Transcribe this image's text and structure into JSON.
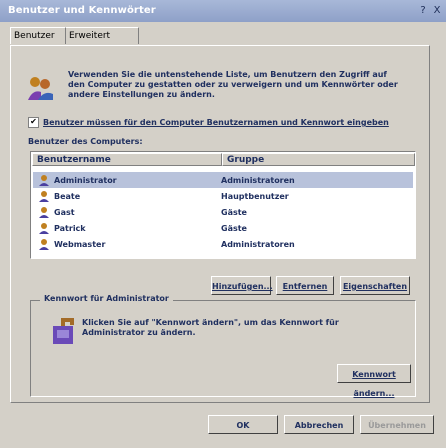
{
  "window": {
    "title": "Benutzer und Kennwörter",
    "help_btn": "?",
    "close_btn": "X"
  },
  "tabs": [
    {
      "label": "Benutzer"
    },
    {
      "label": "Erweitert"
    }
  ],
  "intro_text": "Verwenden Sie die untenstehende Liste, um Benutzern den Zugriff auf den Computer zu gestatten oder zu verweigern und um Kennwörter oder andere Einstellungen zu ändern.",
  "checkbox": {
    "checked": true,
    "label": "Benutzer müssen für den Computer Benutzernamen und Kennwort eingeben"
  },
  "users_label": "Benutzer des Computers:",
  "table": {
    "headers": [
      "Benutzername",
      "Gruppe"
    ],
    "rows": [
      {
        "name": "Administrator",
        "group": "Administratoren"
      },
      {
        "name": "Beate",
        "group": "Hauptbenutzer"
      },
      {
        "name": "Gast",
        "group": "Gäste"
      },
      {
        "name": "Patrick",
        "group": "Gäste"
      },
      {
        "name": "Webmaster",
        "group": "Administratoren"
      }
    ]
  },
  "buttons": {
    "add": "Hinzufügen...",
    "remove": "Entfernen",
    "properties": "Eigenschaften",
    "change_password": "Kennwort ändern...",
    "ok": "OK",
    "cancel": "Abbrechen",
    "apply": "Übernehmen"
  },
  "password_group": {
    "title": "Kennwort für Administrator",
    "text": "Klicken Sie auf \"Kennwort ändern\", um das Kennwort für Administrator zu ändern."
  },
  "colors": {
    "title_bar": "#8ea0c8",
    "text": "#203060",
    "window_bg": "#d4d0c8"
  }
}
